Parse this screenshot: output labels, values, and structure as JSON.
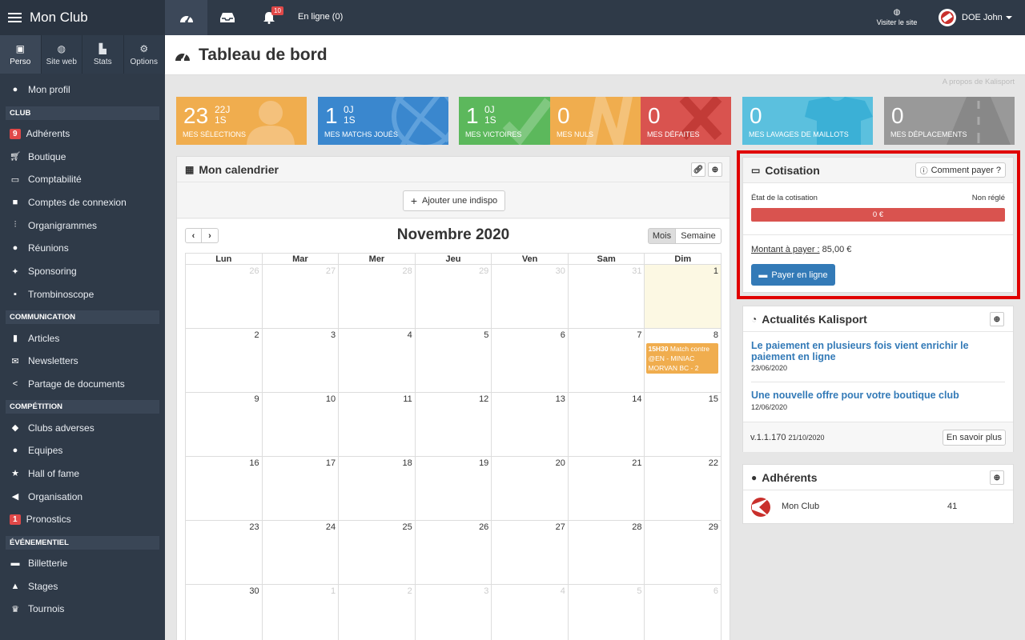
{
  "app": {
    "title": "Mon Club"
  },
  "sidebar": {
    "tabs": [
      {
        "label": "Perso",
        "icon": "person-card-icon"
      },
      {
        "label": "Site web",
        "icon": "globe-icon"
      },
      {
        "label": "Stats",
        "icon": "chart-icon"
      },
      {
        "label": "Options",
        "icon": "gears-icon"
      }
    ],
    "profile": "Mon profil",
    "sections": {
      "club": "CLUB",
      "communication": "COMMUNICATION",
      "competition": "COMPÉTITION",
      "evenementiel": "ÉVÉNEMENTIEL"
    },
    "club_items": [
      "Adhérents",
      "Boutique",
      "Comptabilité",
      "Comptes de connexion",
      "Organigrammes",
      "Réunions",
      "Sponsoring",
      "Trombinoscope"
    ],
    "club_badge": "9",
    "communication_items": [
      "Articles",
      "Newsletters",
      "Partage de documents"
    ],
    "competition_items": [
      "Clubs adverses",
      "Equipes",
      "Hall of fame",
      "Organisation",
      "Pronostics"
    ],
    "pronostics_badge": "1",
    "evenementiel_items": [
      "Billetterie",
      "Stages",
      "Tournois"
    ]
  },
  "topbar": {
    "bell_count": "10",
    "online": "En ligne (0)",
    "visit": "Visiter le site",
    "user": "DOE John"
  },
  "page": {
    "title": "Tableau de bord",
    "about": "A propos de Kalisport"
  },
  "stats": [
    {
      "big": "23",
      "small1": "22J",
      "small2": "1S",
      "label": "MES SÉLECTIONS",
      "color": "#f0ad4e"
    },
    {
      "big": "1",
      "small1": "0J",
      "small2": "1S",
      "label": "MES MATCHS JOUÉS",
      "color": "#3a87ce"
    },
    {
      "big": "1",
      "small1": "0J",
      "small2": "1S",
      "label": "MES VICTOIRES",
      "color": "#5cb85c"
    },
    {
      "big": "0",
      "label": "MES NULS",
      "color": "#f0ad4e"
    },
    {
      "big": "0",
      "label": "MES DÉFAITES",
      "color": "#d9534f"
    },
    {
      "big": "0",
      "label": "MES LAVAGES DE MAILLOTS",
      "color": "#5bc0de"
    },
    {
      "big": "0",
      "label": "MES DÉPLACEMENTS",
      "color": "#999999"
    }
  ],
  "calendar": {
    "title": "Mon calendrier",
    "add_button": "Ajouter une indispo",
    "month": "Novembre 2020",
    "view_month": "Mois",
    "view_week": "Semaine",
    "days": [
      "Lun",
      "Mar",
      "Mer",
      "Jeu",
      "Ven",
      "Sam",
      "Dim"
    ],
    "weeks": [
      [
        "26",
        "27",
        "28",
        "29",
        "30",
        "31",
        "1"
      ],
      [
        "2",
        "3",
        "4",
        "5",
        "6",
        "7",
        "8"
      ],
      [
        "9",
        "10",
        "11",
        "12",
        "13",
        "14",
        "15"
      ],
      [
        "16",
        "17",
        "18",
        "19",
        "20",
        "21",
        "22"
      ],
      [
        "23",
        "24",
        "25",
        "26",
        "27",
        "28",
        "29"
      ],
      [
        "30",
        "1",
        "2",
        "3",
        "4",
        "5",
        "6"
      ]
    ],
    "event_time": "15H30",
    "event_text": "Match contre @EN - MINIAC MORVAN BC - 2"
  },
  "cotisation": {
    "title": "Cotisation",
    "how_to_pay": "Comment payer ?",
    "state_label": "État de la cotisation",
    "state_value": "Non réglé",
    "bar_value": "0 €",
    "amount_label": "Montant à payer :",
    "amount_value": "85,00 €",
    "pay_button": "Payer en ligne"
  },
  "news": {
    "title": "Actualités Kalisport",
    "items": [
      {
        "title": "Le paiement en plusieurs fois vient enrichir le paiement en ligne",
        "date": "23/06/2020"
      },
      {
        "title": "Une nouvelle offre pour votre boutique club",
        "date": "12/06/2020"
      }
    ],
    "version": "v.1.1.170",
    "version_date": "21/10/2020",
    "more": "En savoir plus"
  },
  "adherents": {
    "title": "Adhérents",
    "club": "Mon Club",
    "count": "41"
  }
}
